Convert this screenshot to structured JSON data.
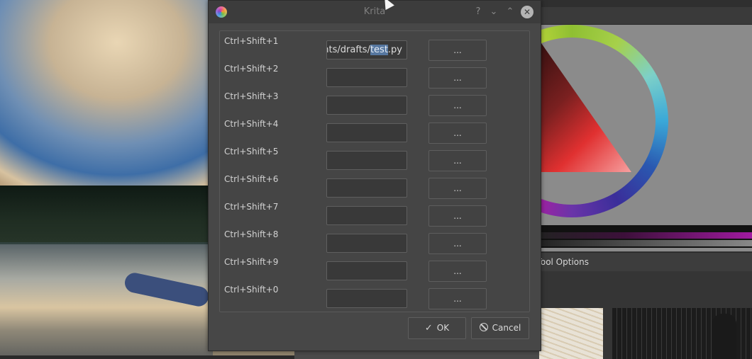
{
  "window": {
    "title": "Krita",
    "help_label": "?",
    "minimize_label": "⌄",
    "maximize_label": "⌃",
    "close_label": "✕"
  },
  "shortcuts": [
    {
      "key": "Ctrl+Shift+1",
      "value": "ents/drafts/",
      "value_selected": "test",
      "value_suffix": ".py",
      "browse_label": "..."
    },
    {
      "key": "Ctrl+Shift+2",
      "value": "",
      "value_selected": "",
      "value_suffix": "",
      "browse_label": "..."
    },
    {
      "key": "Ctrl+Shift+3",
      "value": "",
      "value_selected": "",
      "value_suffix": "",
      "browse_label": "..."
    },
    {
      "key": "Ctrl+Shift+4",
      "value": "",
      "value_selected": "",
      "value_suffix": "",
      "browse_label": "..."
    },
    {
      "key": "Ctrl+Shift+5",
      "value": "",
      "value_selected": "",
      "value_suffix": "",
      "browse_label": "..."
    },
    {
      "key": "Ctrl+Shift+6",
      "value": "",
      "value_selected": "",
      "value_suffix": "",
      "browse_label": "..."
    },
    {
      "key": "Ctrl+Shift+7",
      "value": "",
      "value_selected": "",
      "value_suffix": "",
      "browse_label": "..."
    },
    {
      "key": "Ctrl+Shift+8",
      "value": "",
      "value_selected": "",
      "value_suffix": "",
      "browse_label": "..."
    },
    {
      "key": "Ctrl+Shift+9",
      "value": "",
      "value_selected": "",
      "value_suffix": "",
      "browse_label": "..."
    },
    {
      "key": "Ctrl+Shift+0",
      "value": "",
      "value_selected": "",
      "value_suffix": "",
      "browse_label": "..."
    }
  ],
  "buttons": {
    "ok_label": "OK",
    "cancel_label": "Cancel",
    "ok_icon": "checkmark-icon",
    "cancel_icon": "cancel-icon"
  },
  "background": {
    "tool_options_tab": "Tool Options"
  },
  "colors": {
    "dialog_bg": "#474747",
    "selection": "#5677a0"
  }
}
